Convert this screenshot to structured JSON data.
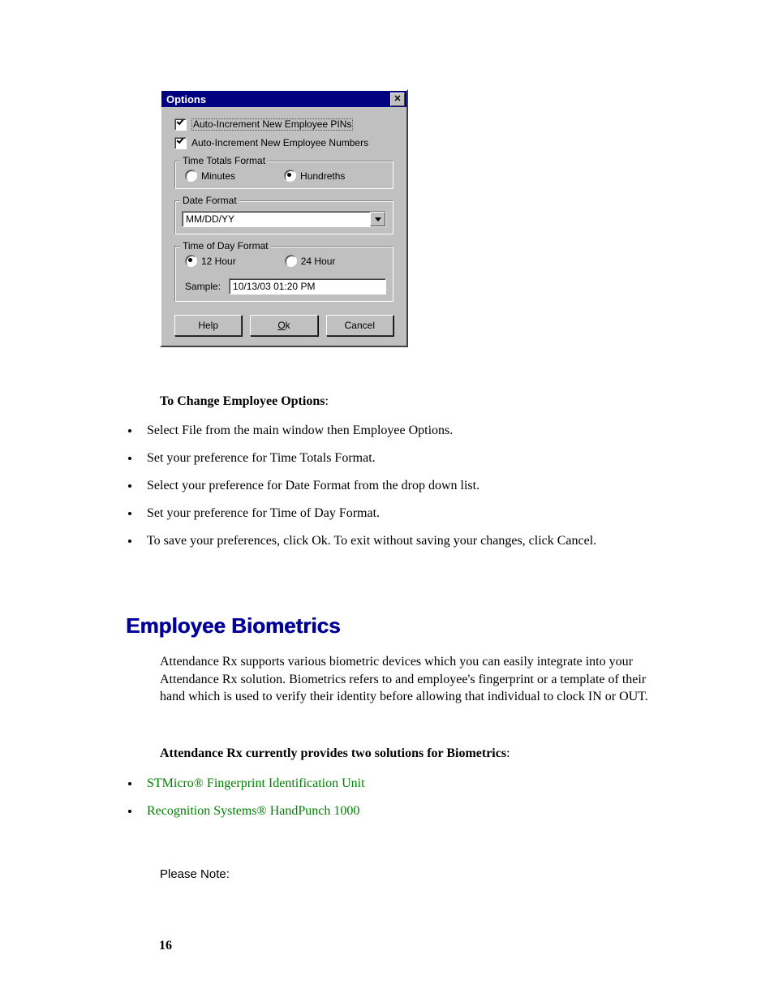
{
  "dialog": {
    "title": "Options",
    "close_glyph": "✕",
    "checks": [
      {
        "label": "Auto-Increment New Employee PINs",
        "checked": true,
        "focused": true
      },
      {
        "label": "Auto-Increment New Employee Numbers",
        "checked": true,
        "focused": false
      }
    ],
    "time_totals": {
      "legend": "Time Totals Format",
      "options": [
        "Minutes",
        "Hundreths"
      ],
      "selected": "Hundreths"
    },
    "date_format": {
      "legend": "Date Format",
      "value": "MM/DD/YY"
    },
    "time_of_day": {
      "legend": "Time of Day Format",
      "options": [
        "12 Hour",
        "24 Hour"
      ],
      "selected": "12 Hour",
      "sample_label": "Sample:",
      "sample_value": "10/13/03 01:20 PM"
    },
    "buttons": {
      "help": "Help",
      "ok_prefix": "O",
      "ok_suffix": "k",
      "cancel": "Cancel"
    }
  },
  "instructions": {
    "heading_prefix": "To Change Employee Options",
    "heading_colon": ":",
    "items": [
      "Select File from the main window then Employee Options.",
      "Set your preference for Time Totals Format.",
      "Select your preference for Date Format from the drop down list.",
      "Set your preference for Time of Day Format.",
      "To save your preferences, click Ok. To exit without saving your changes, click Cancel."
    ]
  },
  "section": {
    "title": "Employee Biometrics",
    "paragraph": "Attendance Rx supports various biometric devices which you can easily integrate into your Attendance Rx solution.  Biometrics refers to and employee's fingerprint or a template of their hand which is used to verify their identity before allowing that individual to clock IN or OUT.",
    "solutions_heading_prefix": "Attendance Rx currently provides two solutions for Biometrics",
    "solutions_heading_colon": ":",
    "links": [
      "STMicro® Fingerprint Identification Unit",
      "Recognition Systems® HandPunch 1000"
    ],
    "note": "Please Note:"
  },
  "page_number": "16"
}
